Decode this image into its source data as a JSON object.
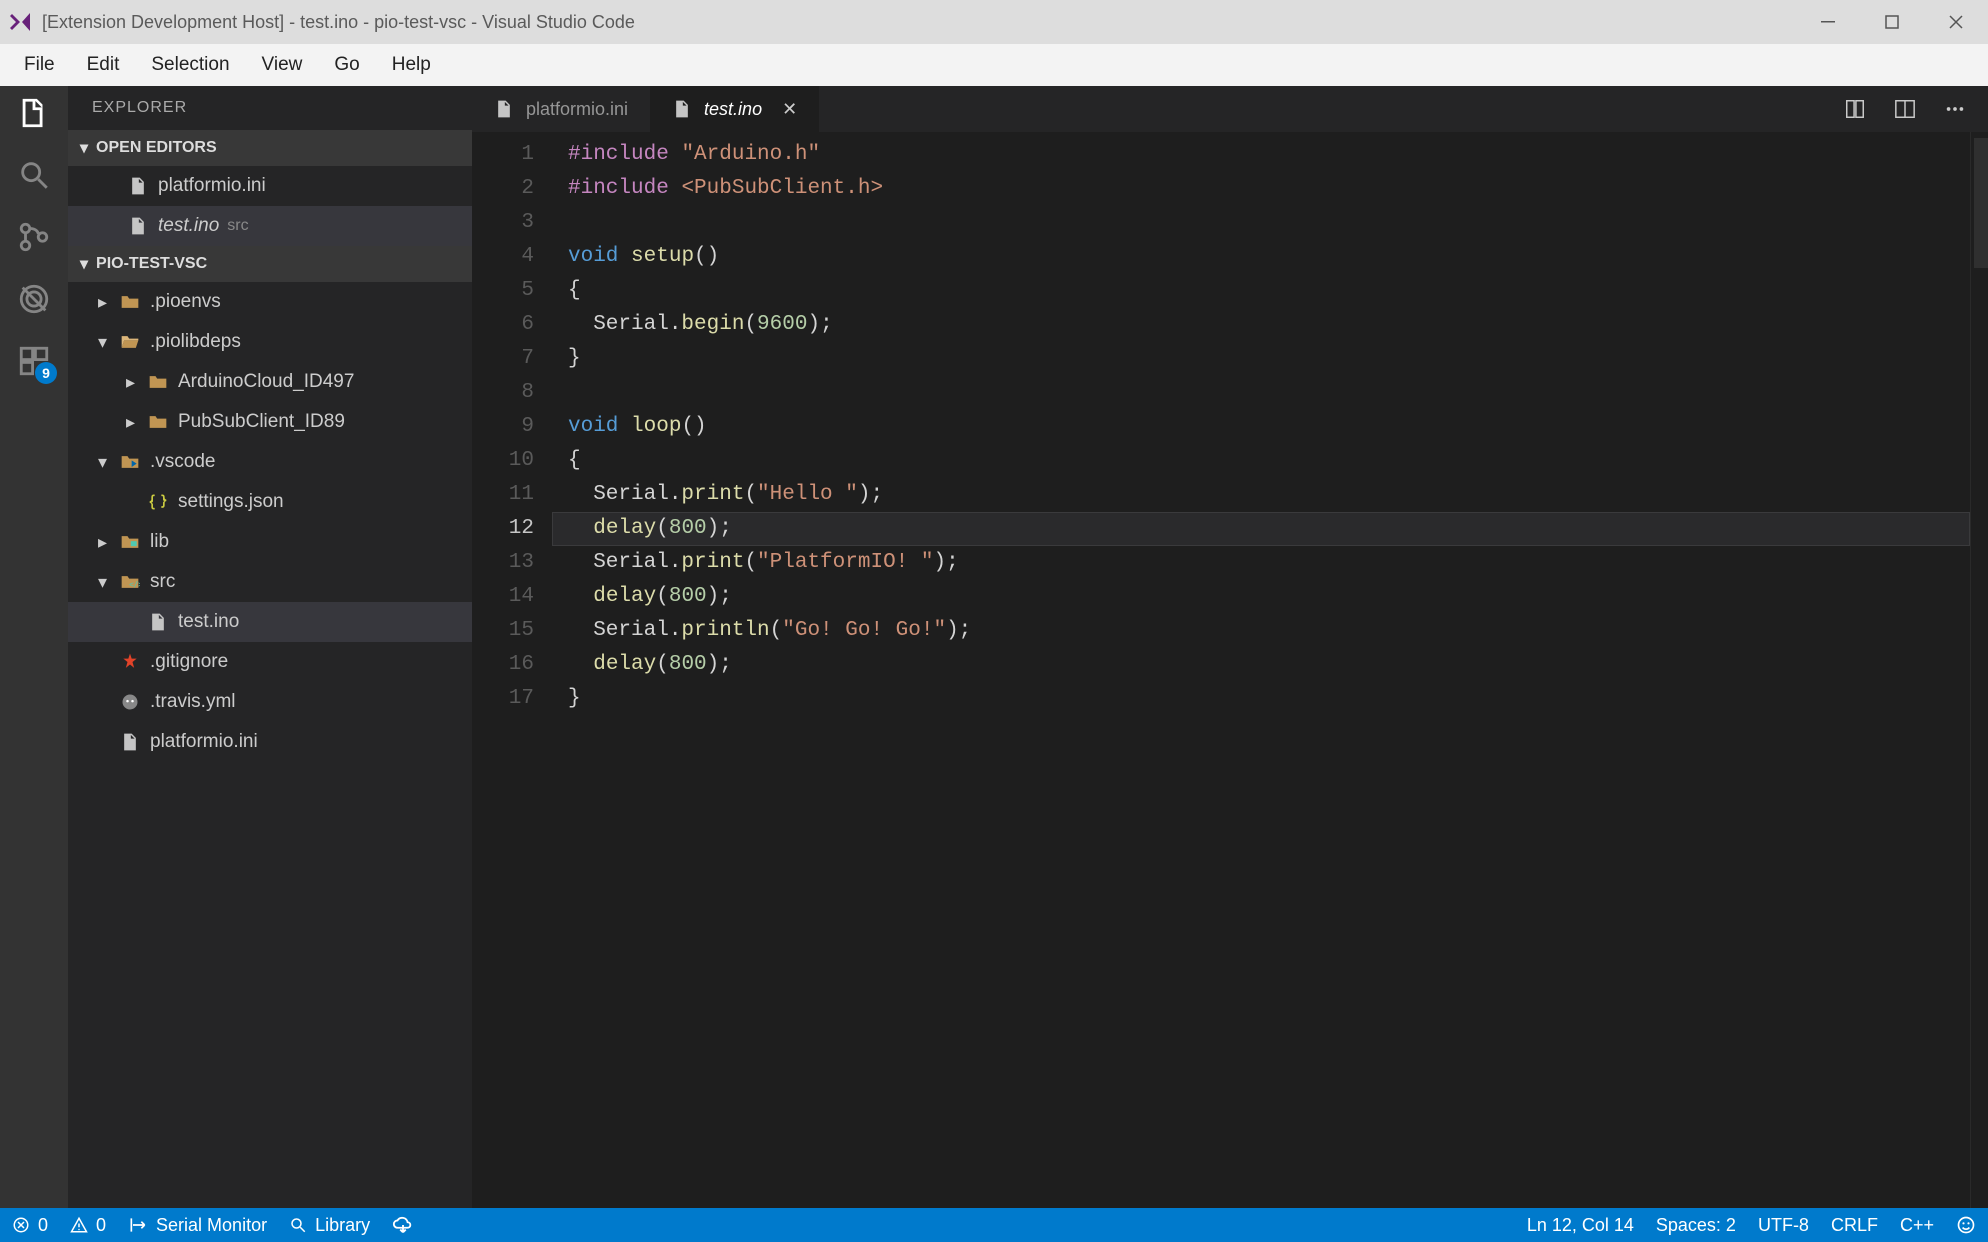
{
  "titlebar": {
    "text": "[Extension Development Host] - test.ino - pio-test-vsc - Visual Studio Code"
  },
  "menubar": [
    "File",
    "Edit",
    "Selection",
    "View",
    "Go",
    "Help"
  ],
  "activitybar": {
    "badge": "9"
  },
  "sidebar": {
    "title": "EXPLORER",
    "sections": {
      "open_editors": "OPEN EDITORS",
      "project": "PIO-TEST-VSC"
    },
    "open_editors": [
      {
        "label": "platformio.ini",
        "dim": ""
      },
      {
        "label": "test.ino",
        "dim": "src",
        "italic": true,
        "selected": true
      }
    ],
    "tree": [
      {
        "indent": 0,
        "chev": "▸",
        "icon": "folder",
        "label": ".pioenvs"
      },
      {
        "indent": 0,
        "chev": "▾",
        "icon": "folder-open",
        "label": ".piolibdeps"
      },
      {
        "indent": 1,
        "chev": "▸",
        "icon": "folder",
        "label": "ArduinoCloud_ID497"
      },
      {
        "indent": 1,
        "chev": "▸",
        "icon": "folder",
        "label": "PubSubClient_ID89"
      },
      {
        "indent": 0,
        "chev": "▾",
        "icon": "folder-vscode",
        "label": ".vscode"
      },
      {
        "indent": 1,
        "chev": "",
        "icon": "json",
        "label": "settings.json"
      },
      {
        "indent": 0,
        "chev": "▸",
        "icon": "folder-lib",
        "label": "lib"
      },
      {
        "indent": 0,
        "chev": "▾",
        "icon": "folder-src",
        "label": "src"
      },
      {
        "indent": 1,
        "chev": "",
        "icon": "file",
        "label": "test.ino",
        "selected": true
      },
      {
        "indent": 0,
        "chev": "",
        "icon": "git",
        "label": ".gitignore"
      },
      {
        "indent": 0,
        "chev": "",
        "icon": "travis",
        "label": ".travis.yml"
      },
      {
        "indent": 0,
        "chev": "",
        "icon": "file",
        "label": "platformio.ini"
      }
    ]
  },
  "tabs": [
    {
      "label": "platformio.ini",
      "active": false,
      "close": false
    },
    {
      "label": "test.ino",
      "active": true,
      "italic": true,
      "close": true
    }
  ],
  "editor": {
    "current_line": 12,
    "lines": [
      {
        "n": 1,
        "tokens": [
          [
            "pp",
            "#include"
          ],
          [
            "punc",
            " "
          ],
          [
            "str",
            "\"Arduino.h\""
          ]
        ]
      },
      {
        "n": 2,
        "tokens": [
          [
            "pp",
            "#include"
          ],
          [
            "punc",
            " "
          ],
          [
            "str",
            "<PubSubClient.h>"
          ]
        ]
      },
      {
        "n": 3,
        "tokens": []
      },
      {
        "n": 4,
        "tokens": [
          [
            "kw",
            "void"
          ],
          [
            "punc",
            " "
          ],
          [
            "fn",
            "setup"
          ],
          [
            "punc",
            "()"
          ]
        ]
      },
      {
        "n": 5,
        "tokens": [
          [
            "punc",
            "{"
          ]
        ]
      },
      {
        "n": 6,
        "tokens": [
          [
            "punc",
            "  Serial."
          ],
          [
            "fn",
            "begin"
          ],
          [
            "punc",
            "("
          ],
          [
            "num",
            "9600"
          ],
          [
            "punc",
            ");"
          ]
        ]
      },
      {
        "n": 7,
        "tokens": [
          [
            "punc",
            "}"
          ]
        ]
      },
      {
        "n": 8,
        "tokens": []
      },
      {
        "n": 9,
        "tokens": [
          [
            "kw",
            "void"
          ],
          [
            "punc",
            " "
          ],
          [
            "fn",
            "loop"
          ],
          [
            "punc",
            "()"
          ]
        ]
      },
      {
        "n": 10,
        "tokens": [
          [
            "punc",
            "{"
          ]
        ]
      },
      {
        "n": 11,
        "tokens": [
          [
            "punc",
            "  Serial."
          ],
          [
            "fn",
            "print"
          ],
          [
            "punc",
            "("
          ],
          [
            "str",
            "\"Hello \""
          ],
          [
            "punc",
            ");"
          ]
        ]
      },
      {
        "n": 12,
        "tokens": [
          [
            "punc",
            "  "
          ],
          [
            "fn",
            "delay"
          ],
          [
            "punc",
            "("
          ],
          [
            "num",
            "800"
          ],
          [
            "punc",
            ");"
          ]
        ]
      },
      {
        "n": 13,
        "tokens": [
          [
            "punc",
            "  Serial."
          ],
          [
            "fn",
            "print"
          ],
          [
            "punc",
            "("
          ],
          [
            "str",
            "\"PlatformIO! \""
          ],
          [
            "punc",
            ");"
          ]
        ]
      },
      {
        "n": 14,
        "tokens": [
          [
            "punc",
            "  "
          ],
          [
            "fn",
            "delay"
          ],
          [
            "punc",
            "("
          ],
          [
            "num",
            "800"
          ],
          [
            "punc",
            ");"
          ]
        ]
      },
      {
        "n": 15,
        "tokens": [
          [
            "punc",
            "  Serial."
          ],
          [
            "fn",
            "println"
          ],
          [
            "punc",
            "("
          ],
          [
            "str",
            "\"Go! Go! Go!\""
          ],
          [
            "punc",
            ");"
          ]
        ]
      },
      {
        "n": 16,
        "tokens": [
          [
            "punc",
            "  "
          ],
          [
            "fn",
            "delay"
          ],
          [
            "punc",
            "("
          ],
          [
            "num",
            "800"
          ],
          [
            "punc",
            ");"
          ]
        ]
      },
      {
        "n": 17,
        "tokens": [
          [
            "punc",
            "}"
          ]
        ]
      }
    ]
  },
  "status": {
    "errors": "0",
    "warnings": "0",
    "serial": "Serial Monitor",
    "library": "Library",
    "pos": "Ln 12, Col 14",
    "spaces": "Spaces: 2",
    "encoding": "UTF-8",
    "eol": "CRLF",
    "lang": "C++"
  }
}
